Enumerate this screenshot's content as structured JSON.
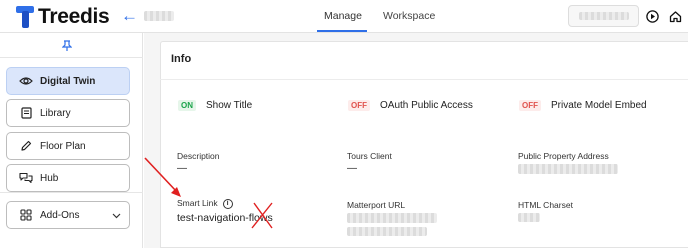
{
  "app": {
    "name": "Treedis"
  },
  "header": {
    "tabs": [
      {
        "label": "Manage",
        "active": true
      },
      {
        "label": "Workspace",
        "active": false
      }
    ]
  },
  "sidebar": {
    "items": [
      {
        "label": "Digital Twin",
        "icon": "eye-icon",
        "active": true
      },
      {
        "label": "Library",
        "icon": "book-icon"
      },
      {
        "label": "Floor Plan",
        "icon": "pencil-icon"
      },
      {
        "label": "Hub",
        "icon": "chat-bubbles-icon"
      },
      {
        "label": "Add-Ons",
        "icon": "grid-icon",
        "expandable": true
      }
    ]
  },
  "info": {
    "title": "Info",
    "toggles": [
      {
        "state": "ON",
        "label": "Show Title"
      },
      {
        "state": "OFF",
        "label": "OAuth Public Access"
      },
      {
        "state": "OFF",
        "label": "Private Model Embed"
      }
    ],
    "fields": {
      "description": {
        "label": "Description",
        "value": "—"
      },
      "tours_client": {
        "label": "Tours Client",
        "value": "—"
      },
      "public_property_address": {
        "label": "Public Property Address"
      },
      "smart_link": {
        "label": "Smart Link",
        "value": "test-navigation-flows"
      },
      "matterport_url": {
        "label": "Matterport URL"
      },
      "html_charset": {
        "label": "HTML Charset"
      }
    }
  },
  "colors": {
    "accent": "#2f6fe8",
    "active_item_bg": "#dbe6fb",
    "on": "#1aa34a",
    "off": "#e0524d",
    "annotation": "#e02020"
  }
}
